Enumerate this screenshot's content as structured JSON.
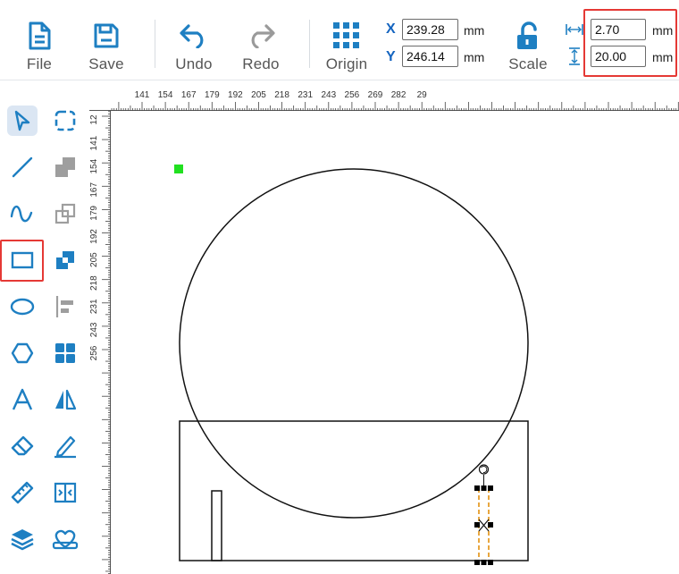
{
  "toolbar": {
    "file_label": "File",
    "save_label": "Save",
    "undo_label": "Undo",
    "redo_label": "Redo",
    "origin_label": "Origin",
    "scale_label": "Scale",
    "x_label": "X",
    "y_label": "Y",
    "x_value": "239.28",
    "y_value": "246.14",
    "unit_mm": "mm",
    "width_value": "2.70",
    "height_value": "20.00",
    "accent_color": "#1e7fc2"
  },
  "tools": [
    {
      "name": "select-tool",
      "icon": "cursor-arrow-icon",
      "active": true
    },
    {
      "name": "node-edit-tool",
      "icon": "dashed-rounded-square-icon"
    },
    {
      "name": "line-tool",
      "icon": "line-icon"
    },
    {
      "name": "weld-tool",
      "icon": "weld-shapes-icon"
    },
    {
      "name": "curve-tool",
      "icon": "wave-curve-icon"
    },
    {
      "name": "group-tool",
      "icon": "overlap-outline-icon"
    },
    {
      "name": "rectangle-tool",
      "icon": "rectangle-icon",
      "highlighted": true
    },
    {
      "name": "combine-tool",
      "icon": "overlap-fill-icon"
    },
    {
      "name": "ellipse-tool",
      "icon": "ellipse-icon"
    },
    {
      "name": "align-tool",
      "icon": "align-left-icon"
    },
    {
      "name": "polygon-tool",
      "icon": "hexagon-icon"
    },
    {
      "name": "array-tool",
      "icon": "grid-squares-icon"
    },
    {
      "name": "text-tool",
      "icon": "text-a-icon"
    },
    {
      "name": "mirror-tool",
      "icon": "mirror-flip-icon"
    },
    {
      "name": "eraser-tool",
      "icon": "eraser-icon"
    },
    {
      "name": "sign-tool",
      "icon": "pen-sign-icon"
    },
    {
      "name": "measure-tool",
      "icon": "ruler-icon"
    },
    {
      "name": "split-tool",
      "icon": "split-frame-icon"
    },
    {
      "name": "layers-tool",
      "icon": "layers-icon"
    },
    {
      "name": "shape-library-tool",
      "icon": "heart-shapes-icon"
    }
  ],
  "ruler": {
    "unit": "mm",
    "top_labels": [
      "141",
      "154",
      "167",
      "179",
      "192",
      "205",
      "218",
      "231",
      "243",
      "256",
      "269",
      "282",
      "29"
    ],
    "left_labels": [
      "12",
      "141",
      "154",
      "167",
      "179",
      "192",
      "205",
      "218",
      "231",
      "243",
      "256"
    ]
  }
}
